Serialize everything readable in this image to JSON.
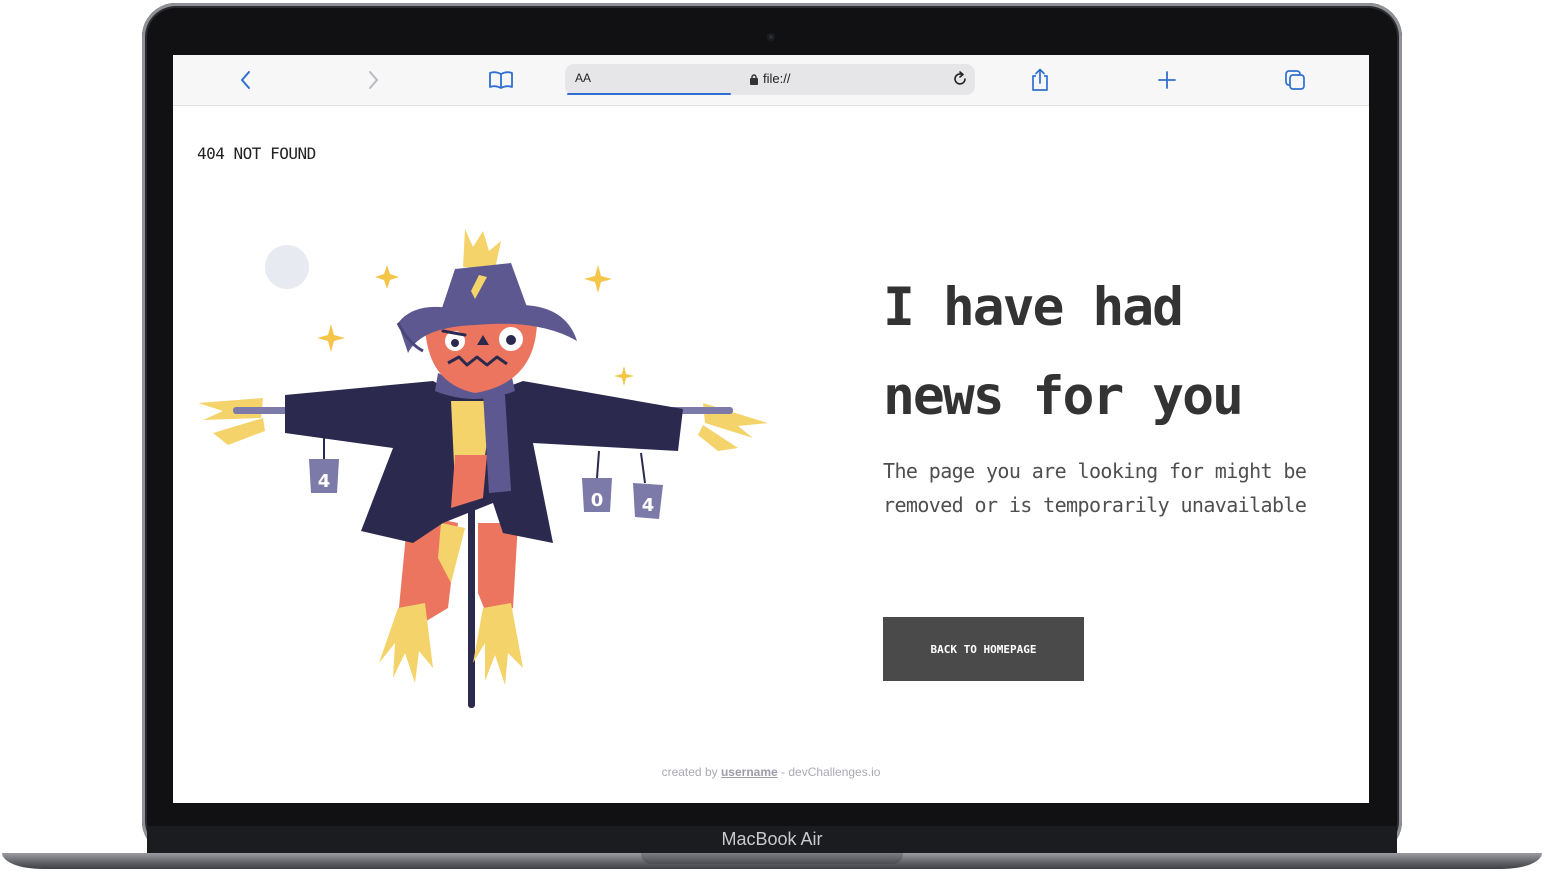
{
  "device": {
    "label": "MacBook Air"
  },
  "browser": {
    "text_size_label": "AA",
    "address": "file://",
    "icons": [
      "back-icon",
      "forward-icon",
      "bookmarks-icon",
      "lock-icon",
      "reload-icon",
      "share-icon",
      "new-tab-icon",
      "tabs-overview-icon"
    ]
  },
  "page": {
    "brand": "404 NOT FOUND",
    "headline_line1": "I have had",
    "headline_line2": "news for you",
    "message": "The page you are looking for might be removed or is temporarily unavailable",
    "cta_label": "BACK TO HOMEPAGE",
    "illustration": {
      "subject": "scarecrow",
      "can_labels": [
        "4",
        "0",
        "4"
      ]
    },
    "footer": {
      "prefix": "created by",
      "username": "username",
      "suffix": "- devChallenges.io"
    }
  },
  "colors": {
    "accent": "#2f6fd1",
    "button_bg": "#4a4a4a",
    "text_dark": "#333333",
    "coat": "#2b2a4e",
    "hat": "#5d5990",
    "face": "#ec7560",
    "straw": "#f5d36b"
  }
}
